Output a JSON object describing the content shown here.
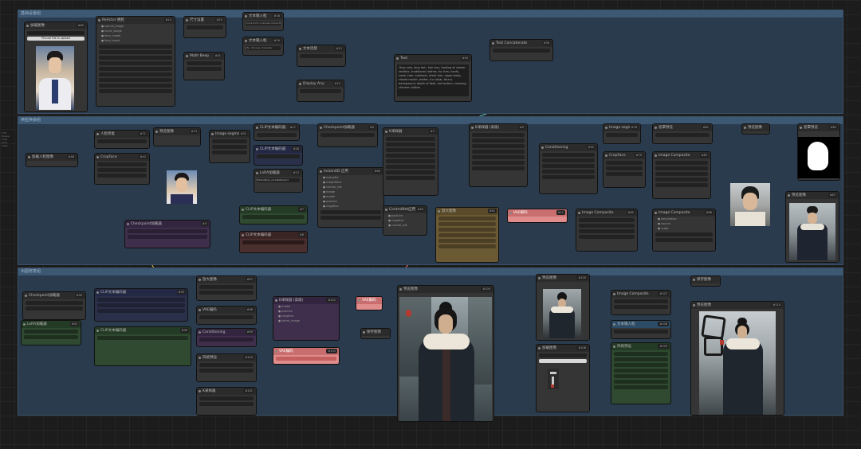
{
  "groups": {
    "top": "基础设置组",
    "middle": "换脸换装组",
    "bottom": "出图修复组"
  },
  "nodes": {
    "load_image_1": "加载图像",
    "load_image_1_file": "Picture file is upload",
    "reactor": "ReActor 换脸",
    "size": "尺寸设置",
    "math": "Math Beep",
    "text_a": "文本输入框",
    "text_a_val": "<lora:pid:1>,female character",
    "text_b": "文本输入框",
    "text_b_val": "pfp, chinese character",
    "concat": "文本连接",
    "preview_text": "Text",
    "preview_text_body": "1boy solo, long hair, hair bun, looking at viewer, realistic, traditional clothes, fur trim, hanfu, snow, tree, outdoors, black hair, upper body, closed mouth, winter, fur collar, blurry background, depth of field, red lantern, snowing, chinese clothes",
    "text_concat": "Text Concatenate",
    "display_any": "Display Any",
    "load_face": "加载人脸图像",
    "face_restore": "人脸修复",
    "crop": "CropFace",
    "segment": "Image segment",
    "clip_text": "CLIP文本编码器",
    "clip_text_2": "CLIP文本编码器",
    "instantid": "InstantID 应用",
    "ksampler": "K采样器",
    "ksampler_2": "K采样器 (高级)",
    "vae_decode": "VAE解码",
    "controlnet": "ControlNet应用",
    "mask_preview": "遮罩预览",
    "preview_1": "预览图像",
    "preview_2": "预览图像",
    "image_composite": "Image Composite",
    "conditioning": "Conditioning",
    "checkpoint": "Checkpoint加载器",
    "lora": "LoRA加载器",
    "lora_val": "HanfuStyle_v2.safetensors",
    "upscale": "放大图像",
    "vae_encode": "VAE编码",
    "vae_decode_2": "VAE解码",
    "save_image": "保存图像",
    "load_image_2": "加载图像",
    "style_preset": "风格预设",
    "preview_3": "预览图像",
    "result_image": "预览图像"
  },
  "side_menu": [
    "T-Fd",
    "Queue",
    "Load",
    "Save",
    "Clear"
  ]
}
